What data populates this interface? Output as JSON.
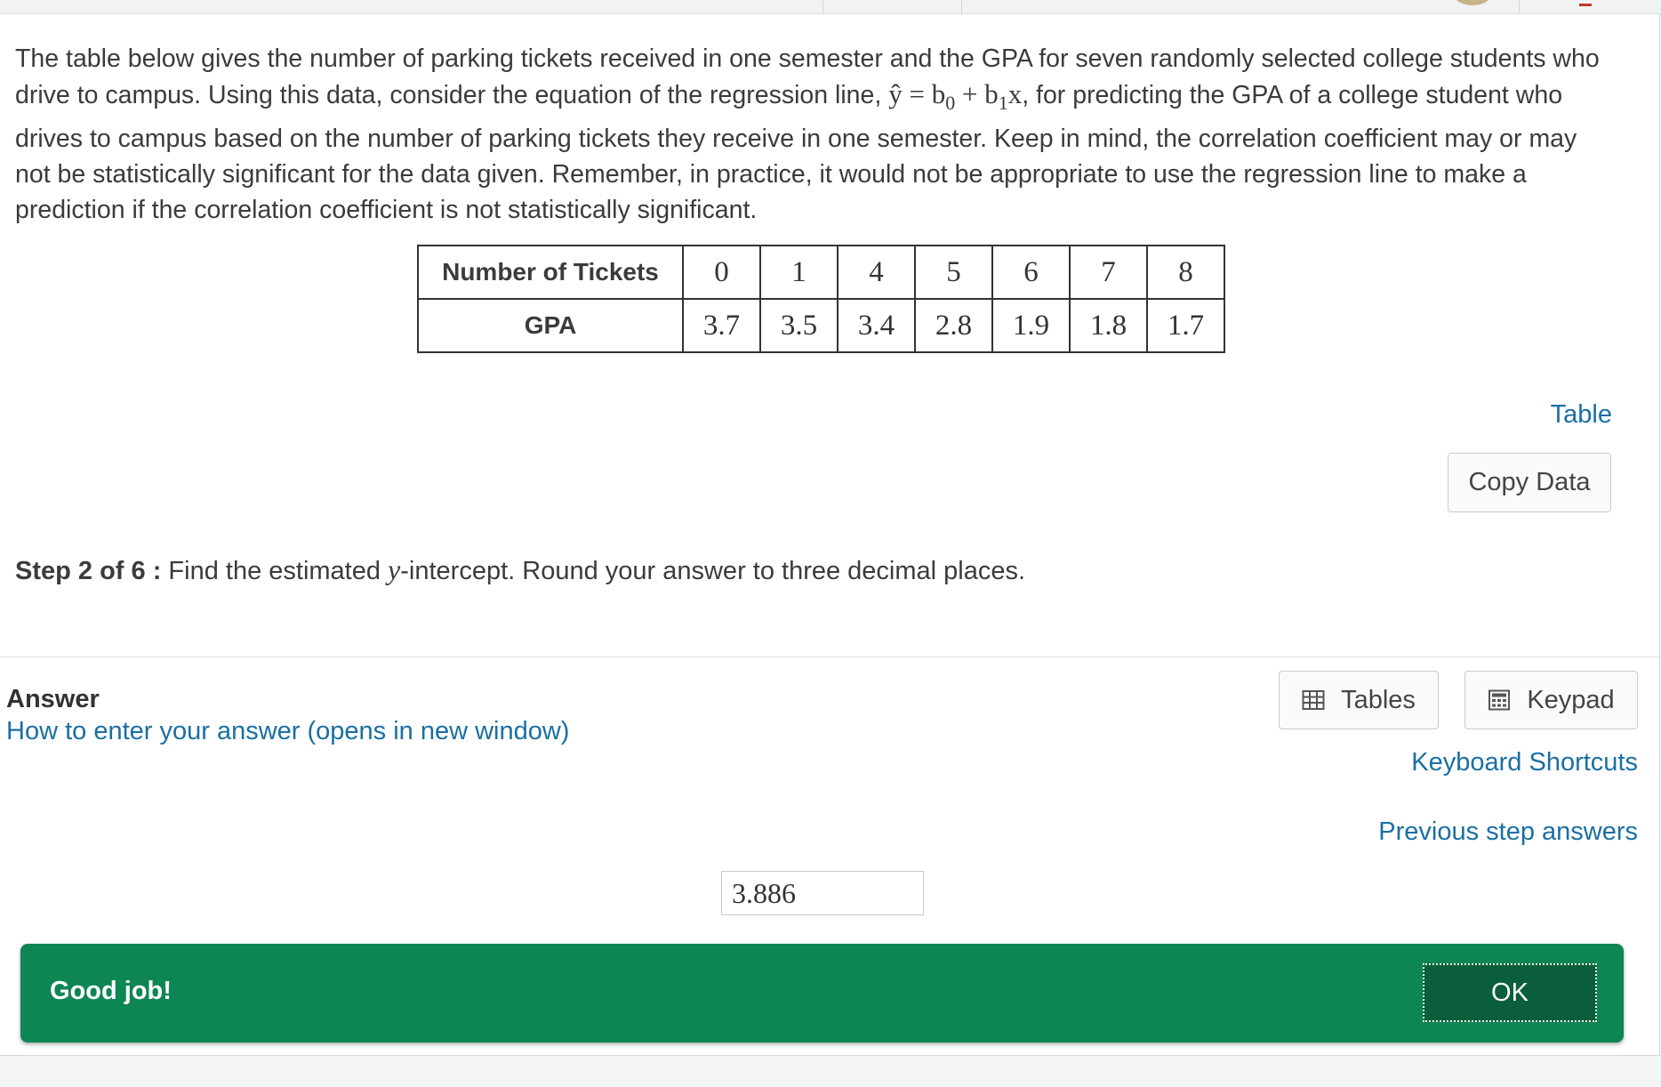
{
  "problem": {
    "intro_1": "The table below gives the number of parking tickets received in one semester and the GPA for seven randomly selected college students who drive to campus. Using this data, consider the equation of the regression line, ",
    "eq_yhat": "ŷ",
    "eq_equals": " = b",
    "eq_sub0": "0",
    "eq_plus": " + b",
    "eq_sub1": "1",
    "eq_x": "x",
    "intro_2": ", for predicting the GPA of a college student who drives to campus based on the number of parking tickets they receive in one semester. Keep in mind, the correlation coefficient may or may not be statistically significant for the data given. Remember, in practice, it would not be appropriate to use the regression line to make a prediction if the correlation coefficient is not statistically significant."
  },
  "table": {
    "rows": [
      {
        "label": "Number of Tickets",
        "values": [
          "0",
          "1",
          "4",
          "5",
          "6",
          "7",
          "8"
        ]
      },
      {
        "label": "GPA",
        "values": [
          "3.7",
          "3.5",
          "3.4",
          "2.8",
          "1.9",
          "1.8",
          "1.7"
        ]
      }
    ],
    "table_link": "Table",
    "copy_data_label": "Copy Data"
  },
  "step": {
    "label": "Step 2 of 6 :",
    "text_before": " Find the estimated ",
    "var": "y",
    "text_after": "-intercept. Round your answer to three decimal places."
  },
  "answer": {
    "title": "Answer",
    "howto_link": "How to enter your answer (opens in new window)",
    "tables_label": "Tables",
    "keypad_label": "Keypad",
    "shortcuts_link": "Keyboard Shortcuts",
    "previous_link": "Previous step answers",
    "value": "3.886"
  },
  "feedback": {
    "message": "Good job!",
    "ok_label": "OK",
    "color": "#0d8654"
  },
  "icons": [
    "table-grid-icon",
    "calculator-icon"
  ]
}
